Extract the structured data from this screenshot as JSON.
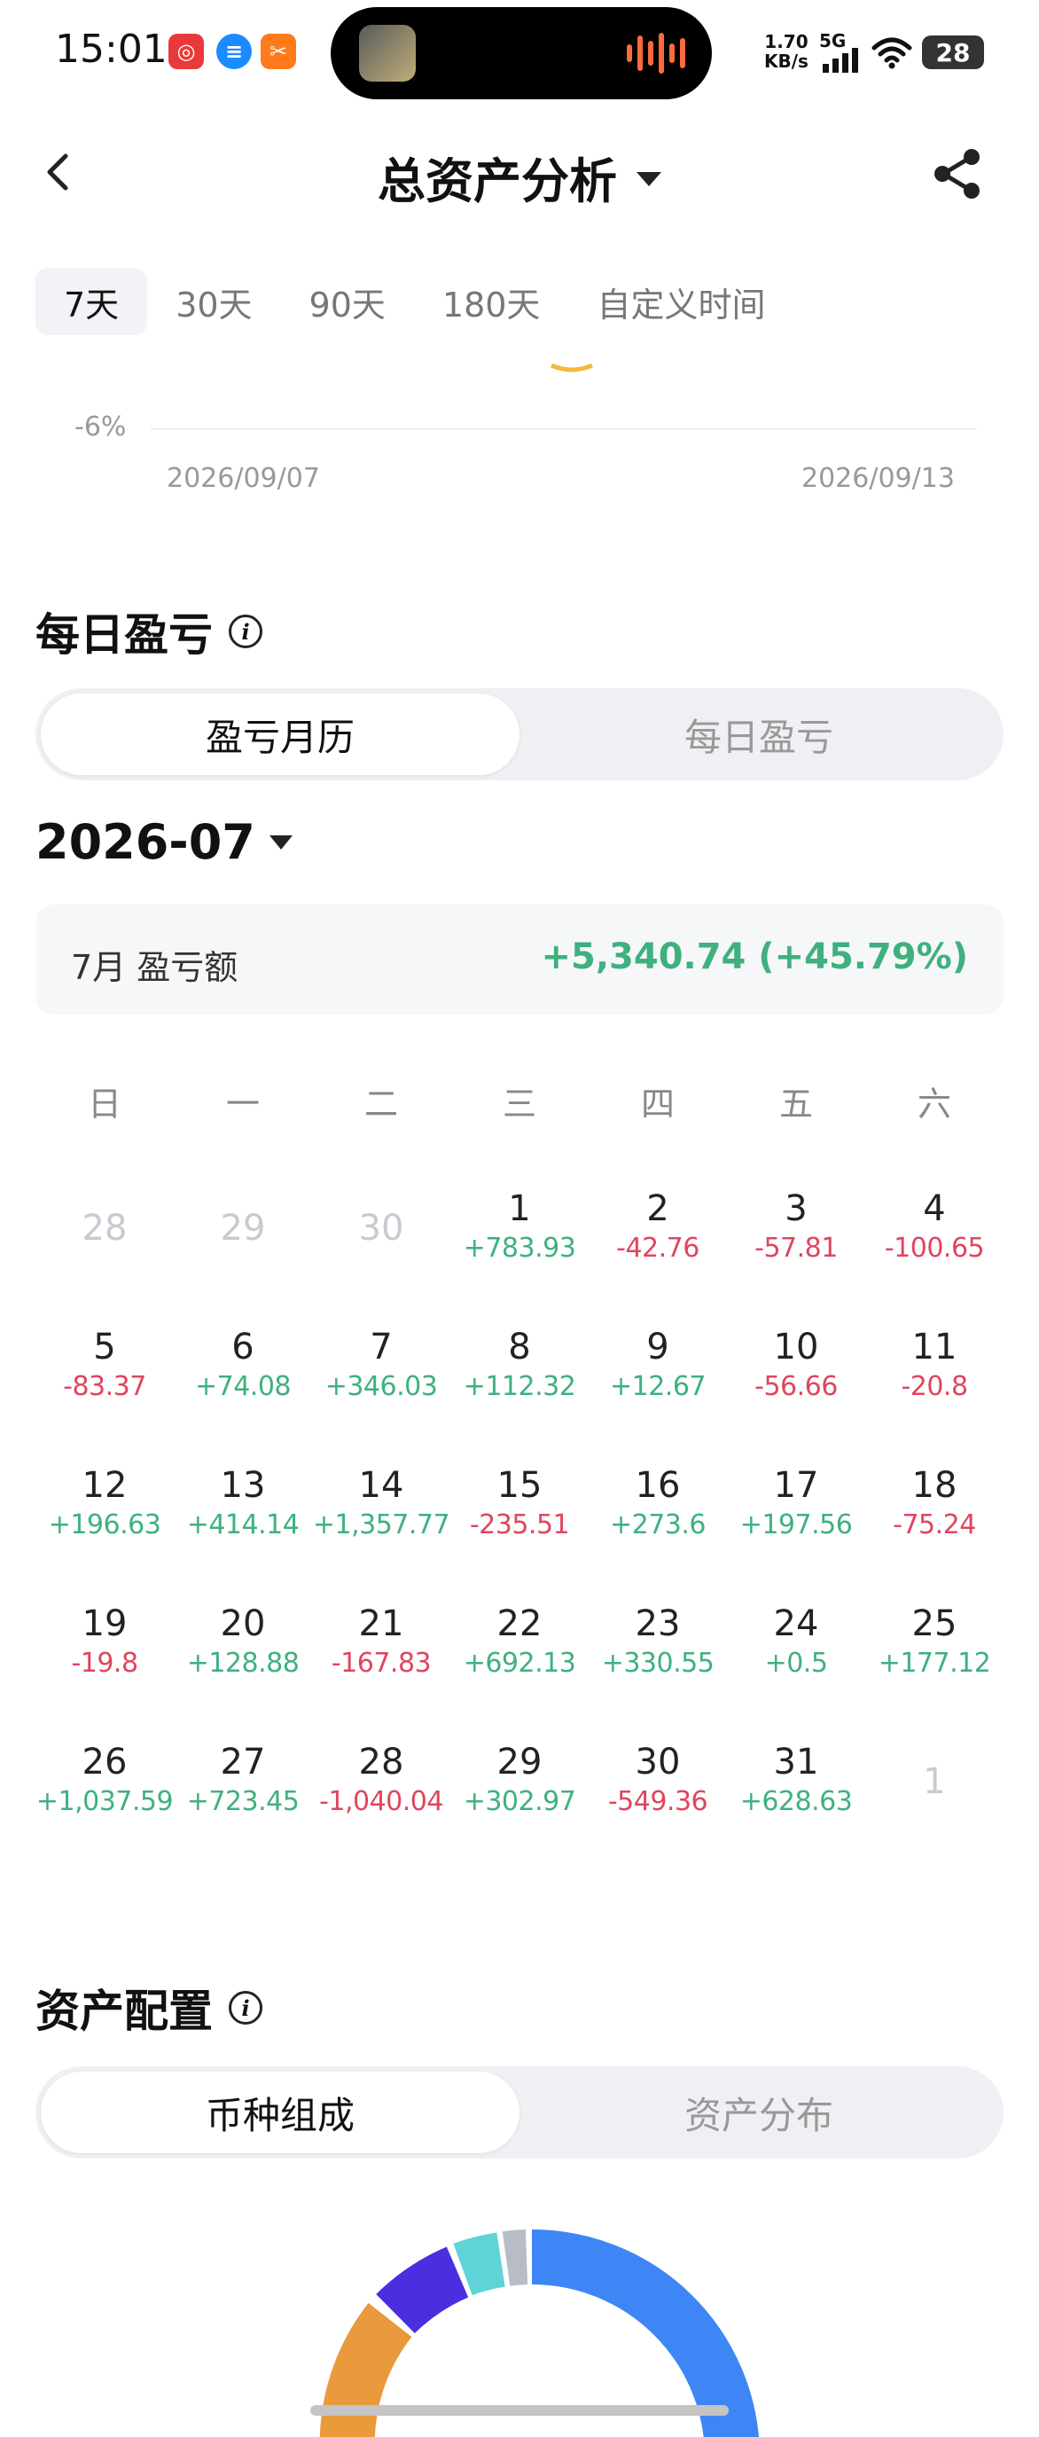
{
  "status_bar": {
    "time": "15:01",
    "net_speed_value": "1.70",
    "net_speed_unit": "KB/s",
    "network": "5G",
    "battery": "28",
    "app_icons": [
      "netease-music-icon",
      "chat-icon",
      "orange-app-icon"
    ],
    "app_colors": [
      "#e83a3a",
      "#1a8cff",
      "#ff7a1a"
    ]
  },
  "header": {
    "title": "总资产分析",
    "back_icon": "chevron-left-icon",
    "share_icon": "share-icon"
  },
  "period_tabs": [
    {
      "label": "7天",
      "active": true
    },
    {
      "label": "30天",
      "active": false
    },
    {
      "label": "90天",
      "active": false
    },
    {
      "label": "180天",
      "active": false
    },
    {
      "label": "自定义时间",
      "active": false
    }
  ],
  "chart": {
    "y_label": "-6%",
    "x_start": "2026/09/07",
    "x_end": "2026/09/13",
    "line_color": "#f5b83a"
  },
  "daily_pnl": {
    "title": "每日盈亏",
    "segments": [
      "盈亏月历",
      "每日盈亏"
    ],
    "active_segment": 0,
    "month": "2026-07",
    "summary_label": "7月 盈亏额",
    "summary_value": "+5,340.74 (+45.79%)",
    "weekdays": [
      "日",
      "一",
      "二",
      "三",
      "四",
      "五",
      "六"
    ],
    "weeks": [
      [
        {
          "d": "28",
          "v": "",
          "muted": true
        },
        {
          "d": "29",
          "v": "",
          "muted": true
        },
        {
          "d": "30",
          "v": "",
          "muted": true
        },
        {
          "d": "1",
          "v": "+783.93",
          "s": "pos"
        },
        {
          "d": "2",
          "v": "-42.76",
          "s": "neg"
        },
        {
          "d": "3",
          "v": "-57.81",
          "s": "neg"
        },
        {
          "d": "4",
          "v": "-100.65",
          "s": "neg"
        }
      ],
      [
        {
          "d": "5",
          "v": "-83.37",
          "s": "neg"
        },
        {
          "d": "6",
          "v": "+74.08",
          "s": "pos"
        },
        {
          "d": "7",
          "v": "+346.03",
          "s": "pos"
        },
        {
          "d": "8",
          "v": "+112.32",
          "s": "pos"
        },
        {
          "d": "9",
          "v": "+12.67",
          "s": "pos"
        },
        {
          "d": "10",
          "v": "-56.66",
          "s": "neg"
        },
        {
          "d": "11",
          "v": "-20.8",
          "s": "neg"
        }
      ],
      [
        {
          "d": "12",
          "v": "+196.63",
          "s": "pos"
        },
        {
          "d": "13",
          "v": "+414.14",
          "s": "pos"
        },
        {
          "d": "14",
          "v": "+1,357.77",
          "s": "pos"
        },
        {
          "d": "15",
          "v": "-235.51",
          "s": "neg"
        },
        {
          "d": "16",
          "v": "+273.6",
          "s": "pos"
        },
        {
          "d": "17",
          "v": "+197.56",
          "s": "pos"
        },
        {
          "d": "18",
          "v": "-75.24",
          "s": "neg"
        }
      ],
      [
        {
          "d": "19",
          "v": "-19.8",
          "s": "neg"
        },
        {
          "d": "20",
          "v": "+128.88",
          "s": "pos"
        },
        {
          "d": "21",
          "v": "-167.83",
          "s": "neg"
        },
        {
          "d": "22",
          "v": "+692.13",
          "s": "pos"
        },
        {
          "d": "23",
          "v": "+330.55",
          "s": "pos"
        },
        {
          "d": "24",
          "v": "+0.5",
          "s": "pos"
        },
        {
          "d": "25",
          "v": "+177.12",
          "s": "pos"
        }
      ],
      [
        {
          "d": "26",
          "v": "+1,037.59",
          "s": "pos"
        },
        {
          "d": "27",
          "v": "+723.45",
          "s": "pos"
        },
        {
          "d": "28",
          "v": "-1,040.04",
          "s": "neg"
        },
        {
          "d": "29",
          "v": "+302.97",
          "s": "pos"
        },
        {
          "d": "30",
          "v": "-549.36",
          "s": "neg"
        },
        {
          "d": "31",
          "v": "+628.63",
          "s": "pos"
        },
        {
          "d": "1",
          "v": "",
          "muted": true
        }
      ]
    ],
    "colors": {
      "positive": "#3fb07e",
      "negative": "#e0455e"
    }
  },
  "asset_allocation": {
    "title": "资产配置",
    "segments": [
      "币种组成",
      "资产分布"
    ],
    "active_segment": 0,
    "donut_colors": [
      "#e89a3c",
      "#4a2fe0",
      "#5fd4d8",
      "#b8bcc6",
      "#3e86f5"
    ]
  }
}
